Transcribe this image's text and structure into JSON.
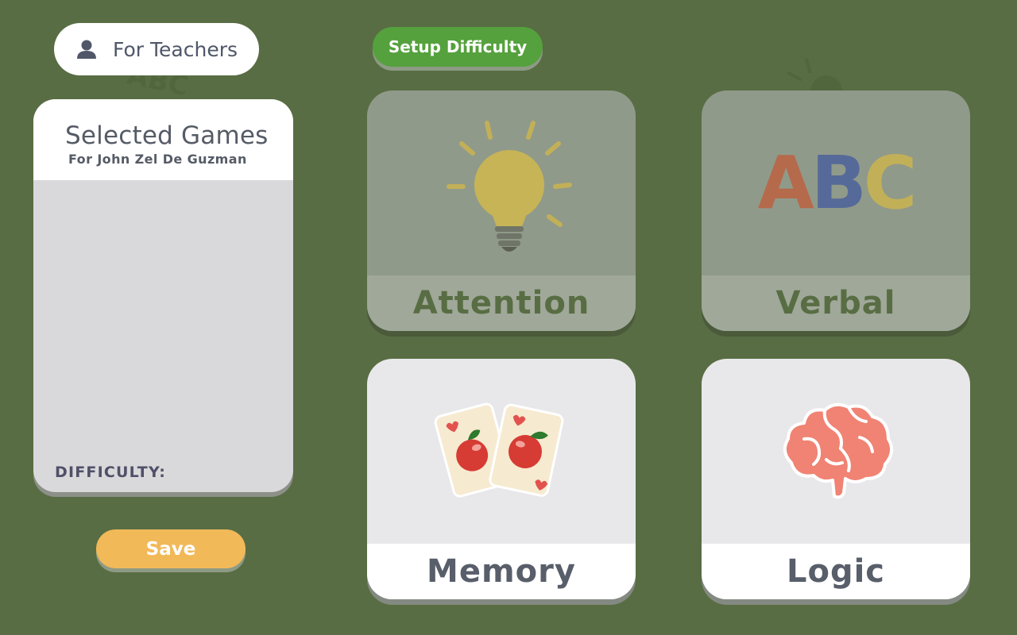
{
  "colors": {
    "background": "#586d43",
    "setup_button": "#55a13d",
    "save_button": "#f2b959",
    "panel": "#d9d9db",
    "text_dark": "#555b66"
  },
  "header": {
    "teacher_button": {
      "label": "For Teachers",
      "icon": "user-icon"
    },
    "setup_button": {
      "label": "Setup Difficulty"
    }
  },
  "panel": {
    "title": "Selected Games",
    "subtitle": "For John Zel De Guzman",
    "difficulty_label": "DIFFICULTY:"
  },
  "save_button": {
    "label": "Save"
  },
  "games": {
    "attention": {
      "label": "Attention",
      "icon": "lightbulb-icon",
      "state": "dimmed"
    },
    "verbal": {
      "label": "Verbal",
      "icon": "abc-letters-icon",
      "art_text": "ABC",
      "state": "dimmed"
    },
    "memory": {
      "label": "Memory",
      "icon": "apple-cards-icon",
      "state": "active"
    },
    "logic": {
      "label": "Logic",
      "icon": "brain-icon",
      "state": "active"
    }
  }
}
